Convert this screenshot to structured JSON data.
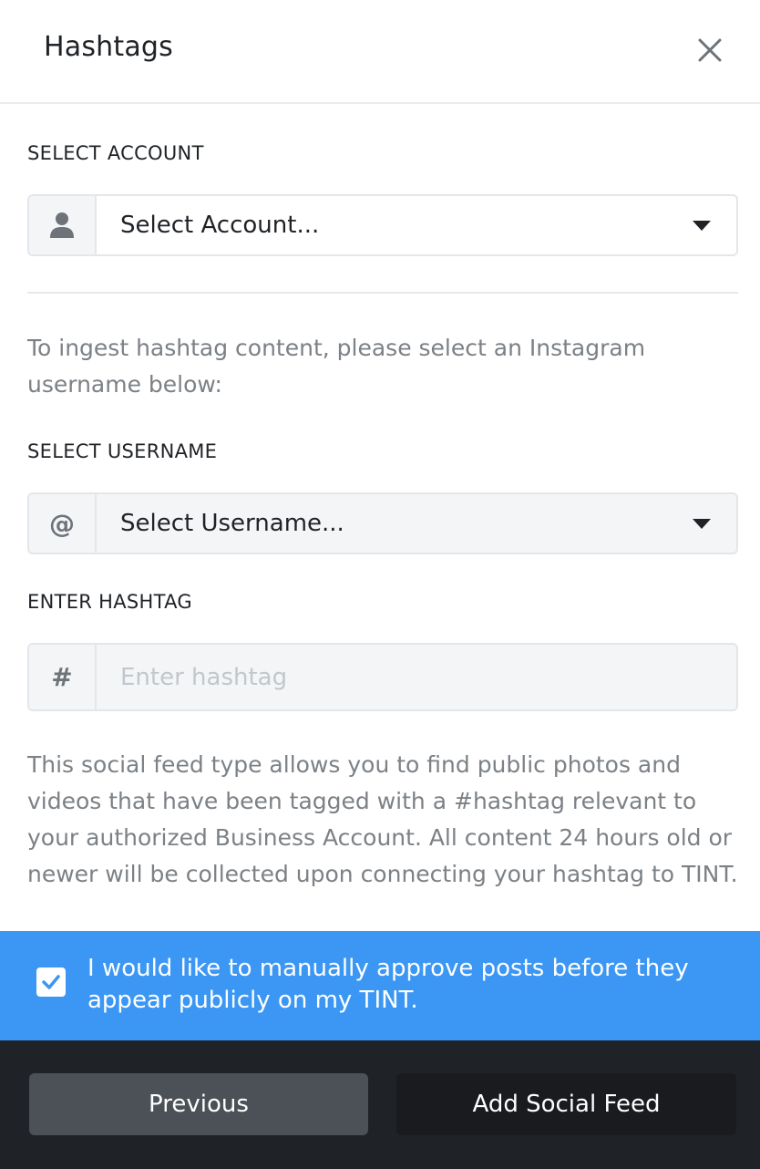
{
  "header": {
    "title": "Hashtags"
  },
  "account": {
    "label": "SELECT ACCOUNT",
    "value": "Select Account..."
  },
  "instructions": "To ingest hashtag content, please select an Instagram username below:",
  "username": {
    "label": "SELECT USERNAME",
    "addon": "@",
    "value": "Select Username..."
  },
  "hashtag": {
    "label": "ENTER HASHTAG",
    "addon": "#",
    "placeholder": "Enter hashtag",
    "value": ""
  },
  "description": "This social feed type allows you to find public photos and videos that have been tagged with a #hashtag relevant to your authorized Business Account. All content 24 hours old or newer will be collected upon connecting your hashtag to TINT.",
  "approve": {
    "checked": true,
    "text": "I would like to manually approve posts before they appear publicly on my TINT."
  },
  "footer": {
    "previous_label": "Previous",
    "add_label": "Add Social Feed"
  },
  "icons": {
    "close": "close-icon",
    "account": "user-icon",
    "caret": "chevron-down-icon",
    "check": "check-icon"
  },
  "colors": {
    "accent": "#3b97f3",
    "footer_bg": "#1f2328",
    "previous_bg": "#4b5157",
    "add_bg": "#191b1e"
  }
}
